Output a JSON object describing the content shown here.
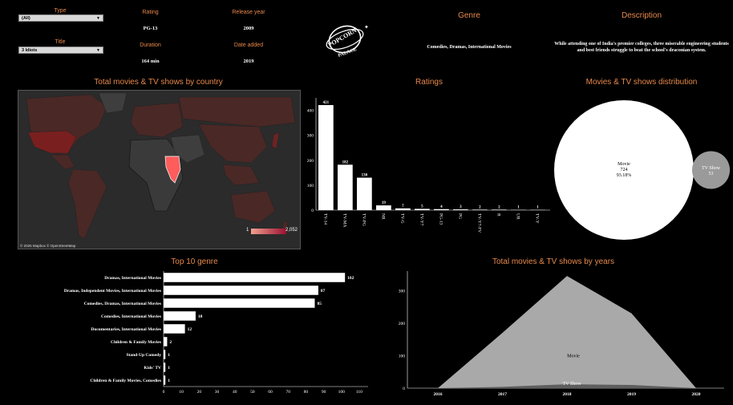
{
  "filters": {
    "type": {
      "label": "Type",
      "value": "(All)"
    },
    "title": {
      "label": "Title",
      "value": "3 Idiots"
    }
  },
  "details": {
    "rating": {
      "label": "Rating",
      "value": "PG-13"
    },
    "release_year": {
      "label": "Release year",
      "value": "2009"
    },
    "duration": {
      "label": "Duration",
      "value": "164 min"
    },
    "date_added": {
      "label": "Date added",
      "value": "2019"
    }
  },
  "logo": {
    "top_text": "POPCORN",
    "bottom_text": "PALACE"
  },
  "genre": {
    "label": "Genre",
    "value": "Comedies, Dramas, International Movies"
  },
  "description": {
    "label": "Description",
    "value": "While attending one of India's premier colleges, three miserable engineering students and best friends struggle to beat the school's draconian system."
  },
  "map": {
    "title": "Total movies & TV shows by country",
    "attribution": "© 2025 Mapbox © OpenStreetMap",
    "legend_min": "1",
    "legend_max": "2,052",
    "colors": {
      "land": "#3a3a3a",
      "low": "#5a2a28",
      "mid": "#7a2020",
      "high": "#ff5c5c"
    }
  },
  "ratings": {
    "title": "Ratings",
    "chart_data": {
      "type": "bar",
      "categories": [
        "TV-14",
        "TV-MA",
        "TV-PG",
        "NR",
        "TV-G",
        "TV-Y7",
        "PG-13",
        "PG",
        "TV-Y7-FV",
        "R",
        "UR",
        "TV-Y"
      ],
      "values": [
        421,
        182,
        130,
        19,
        7,
        5,
        4,
        3,
        2,
        2,
        1,
        1
      ],
      "y_ticks": [
        "0",
        "100",
        "200",
        "300",
        "400"
      ],
      "ylim": [
        0,
        450
      ]
    }
  },
  "distribution": {
    "title": "Movies & TV shows distribution",
    "chart_data": {
      "type": "pie",
      "items": [
        {
          "name": "Movie",
          "count": "724",
          "pct": "93.18%",
          "value": 724
        },
        {
          "name": "TV Show",
          "count": "53",
          "value": 53
        }
      ]
    }
  },
  "top_genre": {
    "title": "Top 10 genre",
    "chart_data": {
      "type": "bar",
      "categories": [
        "Dramas, International Movies",
        "Dramas, Independent Movies, International Movies",
        "Comedies, Dramas, International Movies",
        "Comedies, International Movies",
        "Documentaries, International Movies",
        "Children & Family Movies",
        "Stand-Up Comedy",
        "Kids' TV",
        "Children & Family Movies, Comedies"
      ],
      "values": [
        102,
        87,
        85,
        18,
        12,
        2,
        1,
        1,
        1
      ],
      "x_ticks": [
        "0",
        "10",
        "20",
        "30",
        "40",
        "50",
        "60",
        "70",
        "80",
        "90",
        "100",
        "110"
      ],
      "xlim": [
        0,
        115
      ]
    }
  },
  "years": {
    "title": "Total movies & TV shows by years",
    "chart_data": {
      "type": "area",
      "x": [
        "2016",
        "2017",
        "2018",
        "2019",
        "2020"
      ],
      "series": [
        {
          "name": "Movie",
          "values": [
            0,
            170,
            345,
            230,
            0
          ]
        },
        {
          "name": "TV Show",
          "values": [
            0,
            4,
            12,
            10,
            0
          ]
        }
      ],
      "y_ticks": [
        "0",
        "100",
        "200",
        "300"
      ],
      "ylim": [
        0,
        360
      ]
    }
  }
}
